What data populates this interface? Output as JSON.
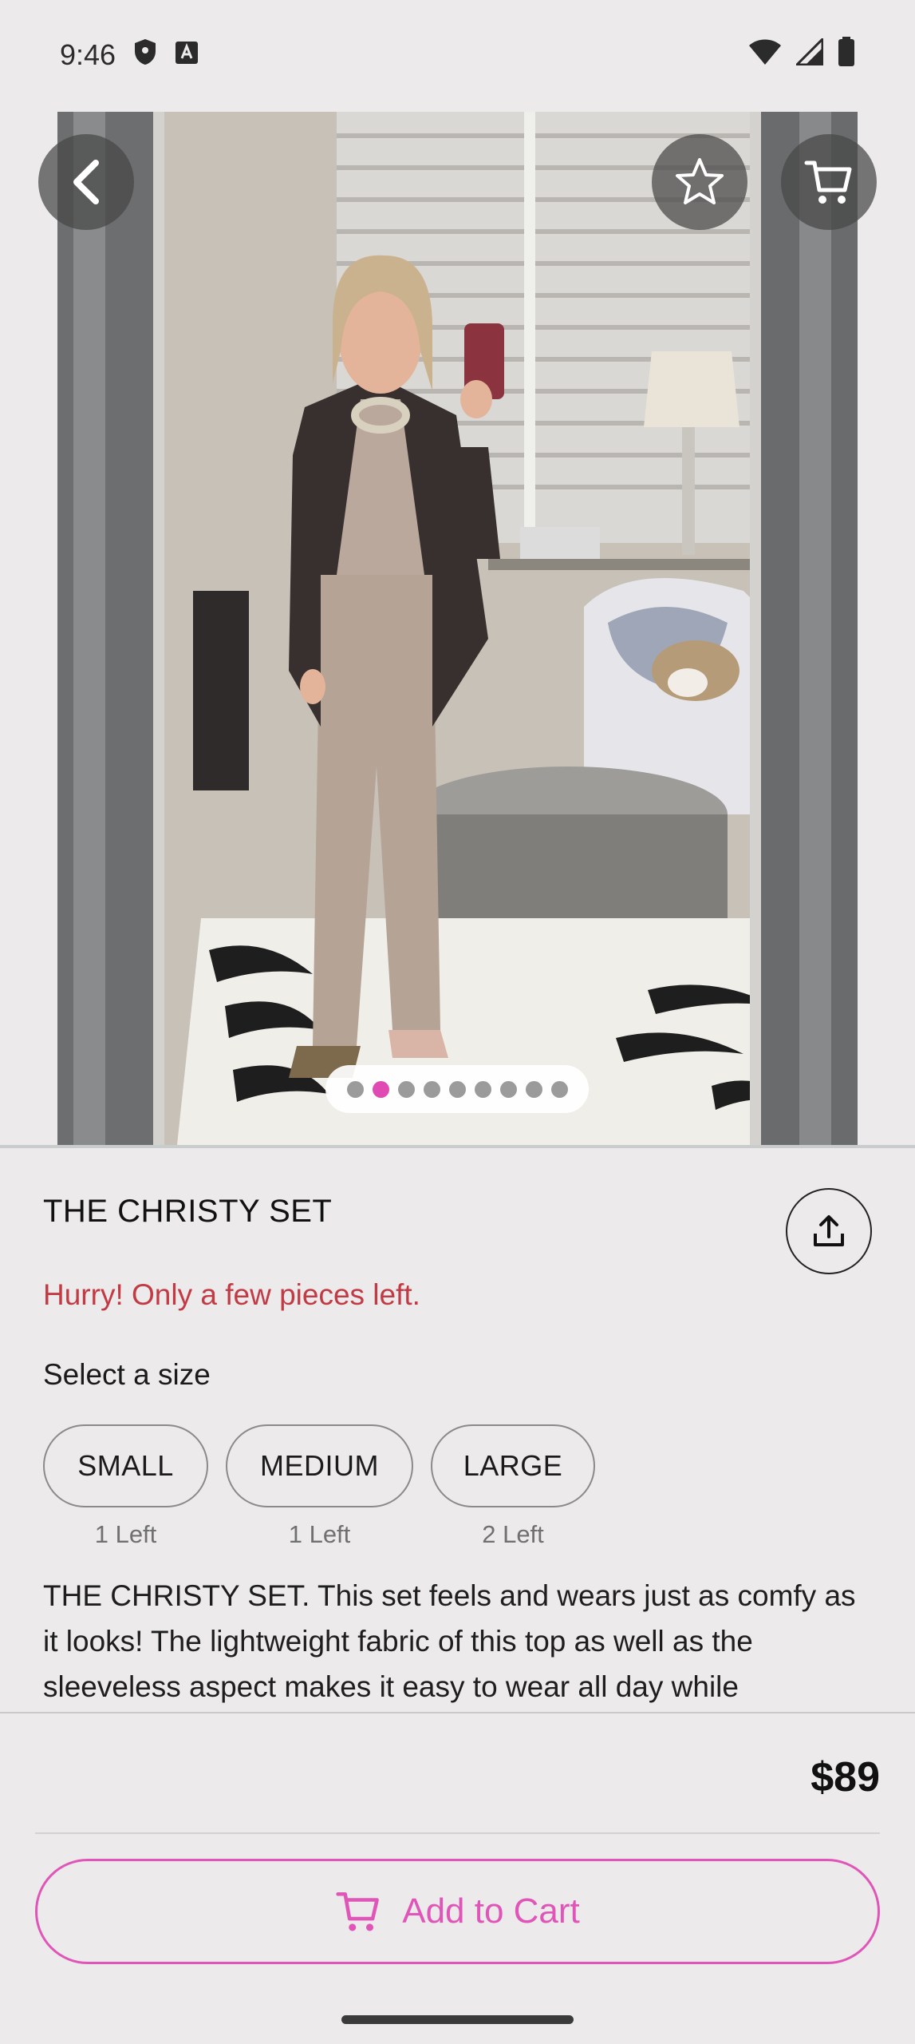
{
  "status_bar": {
    "time": "9:46"
  },
  "product": {
    "title": "THE CHRISTY SET",
    "urgency": "Hurry! Only a few pieces left.",
    "size_label": "Select a size",
    "sizes": [
      {
        "label": "SMALL",
        "stock": "1 Left"
      },
      {
        "label": "MEDIUM",
        "stock": "1 Left"
      },
      {
        "label": "LARGE",
        "stock": "2 Left"
      }
    ],
    "description": "THE CHRISTY SET. This set feels and wears just as comfy as it looks! The lightweight fabric of this top as well as the sleeveless aspect makes it easy to wear all day while",
    "price": "$89",
    "add_to_cart": "Add to Cart"
  },
  "carousel": {
    "total": 9,
    "active_index": 1
  },
  "colors": {
    "accent": "#e055b8",
    "urgency": "#c23a44"
  },
  "icons": [
    "back-icon",
    "star-icon",
    "cart-icon",
    "share-icon"
  ]
}
